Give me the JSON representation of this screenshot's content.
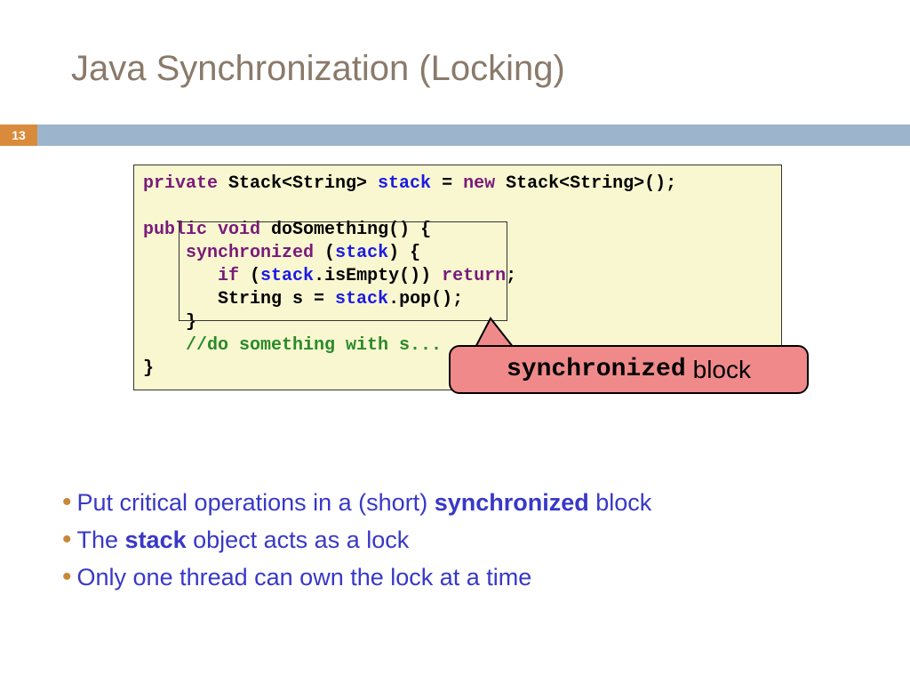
{
  "title": "Java Synchronization (Locking)",
  "page_number": "13",
  "code": {
    "l1a": "private",
    "l1b": " Stack<String> ",
    "l1c": "stack",
    "l1d": " = ",
    "l1e": "new",
    "l1f": " Stack<String>();",
    "l2": "",
    "l3a": "public",
    "l3b": " ",
    "l3c": "void",
    "l3d": " doSomething() {",
    "l4a": "    ",
    "l4b": "synchronized",
    "l4c": " (",
    "l4d": "stack",
    "l4e": ") {",
    "l5a": "       ",
    "l5b": "if",
    "l5c": " (",
    "l5d": "stack",
    "l5e": ".isEmpty()) ",
    "l5f": "return",
    "l5g": ";",
    "l6a": "       String s = ",
    "l6b": "stack",
    "l6c": ".pop();",
    "l7": "    }",
    "l8a": "    ",
    "l8b": "//do something with s...",
    "l9": "}"
  },
  "callout": {
    "mono": "synchronized",
    "label": "block"
  },
  "bullets": [
    {
      "pre": "Put critical operations in a (short) ",
      "bold": "synchronized",
      "post": " block"
    },
    {
      "pre": "The ",
      "bold": "stack",
      "post": " object acts as a lock"
    },
    {
      "pre": "Only one thread can own the lock at a time",
      "bold": "",
      "post": ""
    }
  ]
}
